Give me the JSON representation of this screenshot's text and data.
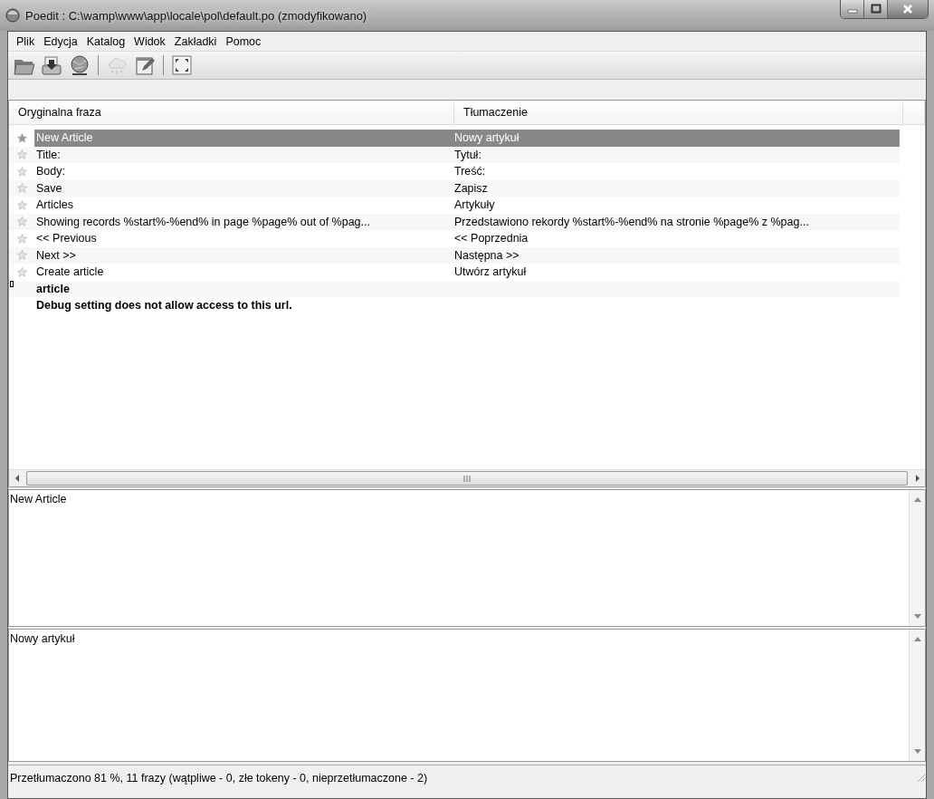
{
  "window": {
    "title": "Poedit : C:\\wamp\\www\\app\\locale\\pol\\default.po (zmodyfikowano)"
  },
  "menu": [
    "Plik",
    "Edycja",
    "Katalog",
    "Widok",
    "Zakładki",
    "Pomoc"
  ],
  "toolbar": [
    {
      "kind": "button",
      "disabled": false
    },
    {
      "kind": "button",
      "disabled": false
    },
    {
      "kind": "button",
      "disabled": false
    },
    {
      "kind": "separator"
    },
    {
      "kind": "button",
      "disabled": true
    },
    {
      "kind": "button",
      "disabled": false
    },
    {
      "kind": "separator"
    },
    {
      "kind": "button",
      "disabled": false
    }
  ],
  "list": {
    "columns": [
      "Oryginalna fraza",
      "Tłumaczenie"
    ],
    "rows": [
      {
        "kind": "translated",
        "source": "New Article",
        "translation": "Nowy artykuł",
        "selected": true,
        "marked": false
      },
      {
        "kind": "translated",
        "source": "Title:",
        "translation": "Tytuł:",
        "selected": false,
        "marked": false
      },
      {
        "kind": "translated",
        "source": "Body:",
        "translation": "Treść:",
        "selected": false,
        "marked": false
      },
      {
        "kind": "translated",
        "source": "Save",
        "translation": "Zapisz",
        "selected": false,
        "marked": false
      },
      {
        "kind": "translated",
        "source": "Articles",
        "translation": "Artykuły",
        "selected": false,
        "marked": false
      },
      {
        "kind": "translated",
        "source": "Showing records %start%-%end% in page %page% out of %pag...",
        "translation": "Przedstawiono rekordy %start%-%end% na stronie %page% z %pag...",
        "selected": false,
        "marked": false
      },
      {
        "kind": "translated",
        "source": "<< Previous",
        "translation": "<< Poprzednia",
        "selected": false,
        "marked": false
      },
      {
        "kind": "translated",
        "source": "Next >>",
        "translation": "Następna >>",
        "selected": false,
        "marked": false
      },
      {
        "kind": "translated",
        "source": "Create article",
        "translation": "Utwórz artykuł",
        "selected": false,
        "marked": false
      },
      {
        "kind": "untranslated",
        "source": "article",
        "selected": false,
        "marked": true
      },
      {
        "kind": "untranslated",
        "source": "Debug setting does not allow access to this url.",
        "selected": false,
        "marked": false
      }
    ]
  },
  "source_pane": {
    "text": "New Article"
  },
  "translation_pane": {
    "text": "Nowy artykuł"
  },
  "status_bar": "Przetłumaczono 81 %, 11 frazy (wątpliwe - 0, złe tokeny - 0, nieprzetłumaczone - 2)"
}
